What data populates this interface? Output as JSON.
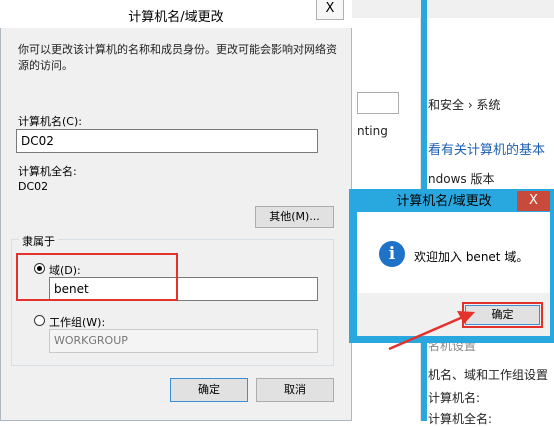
{
  "dialog": {
    "title": "计算机名/域更改",
    "close_glyph": "X",
    "description": "你可以更改该计算机的名称和成员身份。更改可能会影响对网络资源的访问。",
    "computer_name_label": "计算机名(C):",
    "computer_name_value": "DC02",
    "full_name_label": "计算机全名:",
    "full_name_value": "DC02",
    "more_button": "其他(M)...",
    "member_of_label": "隶属于",
    "domain_label": "域(D):",
    "domain_value": "benet",
    "domain_selected": true,
    "workgroup_label": "工作组(W):",
    "workgroup_value": "WORKGROUP",
    "ok_button": "确定",
    "cancel_button": "取消"
  },
  "popup": {
    "title": "计算机名/域更改",
    "close_glyph": "X",
    "message": "欢迎加入 benet 域。",
    "icon": "info-icon",
    "ok_button": "确定"
  },
  "background_window": {
    "partial_nav": "和安全 › 系统",
    "partial_heading": "看有关计算机的基本",
    "partial_line1": "nting",
    "partial_line2": "ndows 版本",
    "partial_line3": "名机设置",
    "partial_section": "机名、域和工作组设置",
    "partial_line4": "计算机名:",
    "partial_line5": "计算机全名:"
  },
  "colors": {
    "highlight": "#e3312b",
    "popup_frame": "#29a8e0",
    "info_icon": "#1e72c8"
  }
}
